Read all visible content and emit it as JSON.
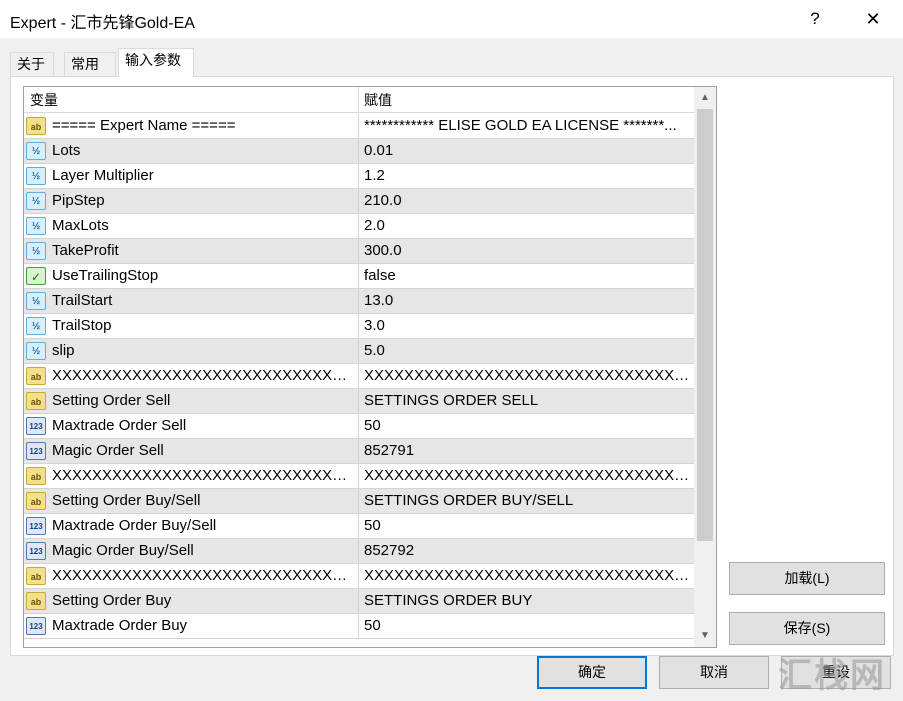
{
  "window": {
    "title": "Expert - 汇市先锋Gold-EA",
    "help_label": "?",
    "close_label": "✕"
  },
  "tabs": [
    {
      "label": "关于"
    },
    {
      "label": "常用"
    },
    {
      "label": "输入参数"
    }
  ],
  "grid": {
    "columns": [
      "变量",
      "赋值"
    ],
    "rows": [
      {
        "icon": "ab",
        "name": "===== Expert Name =====",
        "value": "************ ELISE GOLD EA LICENSE *******..."
      },
      {
        "icon": "half",
        "name": "Lots",
        "value": "0.01"
      },
      {
        "icon": "half",
        "name": "Layer Multiplier",
        "value": "1.2"
      },
      {
        "icon": "half",
        "name": "PipStep",
        "value": "210.0"
      },
      {
        "icon": "half",
        "name": "MaxLots",
        "value": "2.0"
      },
      {
        "icon": "half",
        "name": "TakeProfit",
        "value": "300.0"
      },
      {
        "icon": "bool",
        "name": "UseTrailingStop",
        "value": "false"
      },
      {
        "icon": "half",
        "name": "TrailStart",
        "value": "13.0"
      },
      {
        "icon": "half",
        "name": "TrailStop",
        "value": "3.0"
      },
      {
        "icon": "half",
        "name": "slip",
        "value": "5.0"
      },
      {
        "icon": "ab",
        "name": "XXXXXXXXXXXXXXXXXXXXXXXXXXXXXX...",
        "value": "XXXXXXXXXXXXXXXXXXXXXXXXXXXXXXXXXX"
      },
      {
        "icon": "ab",
        "name": "Setting Order Sell",
        "value": "SETTINGS ORDER SELL"
      },
      {
        "icon": "num",
        "name": "Maxtrade Order Sell",
        "value": "50"
      },
      {
        "icon": "num",
        "name": "Magic Order Sell",
        "value": "852791"
      },
      {
        "icon": "ab",
        "name": "XXXXXXXXXXXXXXXXXXXXXXXXXXXXXX...",
        "value": "XXXXXXXXXXXXXXXXXXXXXXXXXXXXXXXXXX"
      },
      {
        "icon": "ab",
        "name": "Setting Order Buy/Sell",
        "value": "SETTINGS ORDER BUY/SELL"
      },
      {
        "icon": "num",
        "name": "Maxtrade Order Buy/Sell",
        "value": "50"
      },
      {
        "icon": "num",
        "name": "Magic Order Buy/Sell",
        "value": "852792"
      },
      {
        "icon": "ab",
        "name": "XXXXXXXXXXXXXXXXXXXXXXXXXXXXXX...",
        "value": "XXXXXXXXXXXXXXXXXXXXXXXXXXXXXXXXXX"
      },
      {
        "icon": "ab",
        "name": "Setting Order Buy",
        "value": "SETTINGS ORDER BUY"
      },
      {
        "icon": "num",
        "name": "Maxtrade Order Buy",
        "value": "50"
      }
    ]
  },
  "buttons": {
    "load": "加载(L)",
    "save": "保存(S)",
    "ok": "确定",
    "cancel": "取消",
    "reset": "重设"
  },
  "watermark": "汇栈网",
  "icon_glyphs": {
    "ab": "ab",
    "half": "½",
    "num": "123",
    "bool": "✓"
  },
  "colors": {
    "selected_border": "#0078d7",
    "row_alt": "#e6e6e6"
  }
}
